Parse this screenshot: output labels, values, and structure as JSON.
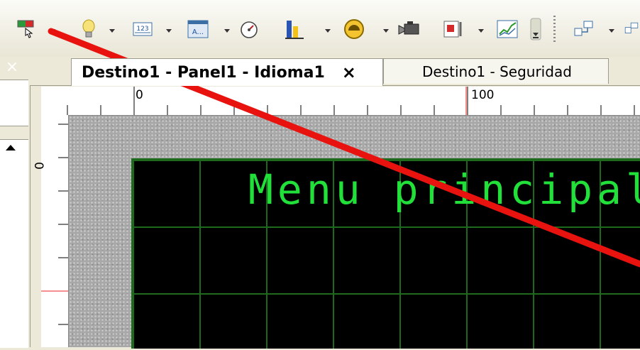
{
  "toolbar": {
    "buttons": [
      {
        "icon": "screen-select-icon"
      },
      {
        "icon": "lightbulb-icon"
      },
      {
        "icon": "numeric-display-icon",
        "text": "123"
      },
      {
        "icon": "text-display-icon",
        "text": "A..."
      },
      {
        "icon": "gauge-icon"
      },
      {
        "icon": "bar-graph-icon"
      },
      {
        "icon": "circle-indicator-icon"
      },
      {
        "icon": "camera-icon"
      },
      {
        "icon": "alarm-list-icon"
      },
      {
        "icon": "trend-chart-icon"
      },
      {
        "icon": "toolbar-overflow-icon"
      },
      {
        "icon": "layout-icon"
      }
    ]
  },
  "left_panel": {
    "close_label": "×"
  },
  "tabs": [
    {
      "label": "Destino1 - Panel1 - Idioma1",
      "active": true,
      "close_label": "×"
    },
    {
      "label": "Destino1 - Seguridad",
      "active": false
    }
  ],
  "ruler_top": {
    "labels": [
      "0",
      "100"
    ]
  },
  "ruler_left": {
    "labels": [
      "0"
    ]
  },
  "panel": {
    "title": "Menu principal",
    "title_color": "#22e03a",
    "background": "#000000",
    "grid_color": "#1d6a1d"
  },
  "annotation": {
    "color": "#e8130f"
  }
}
